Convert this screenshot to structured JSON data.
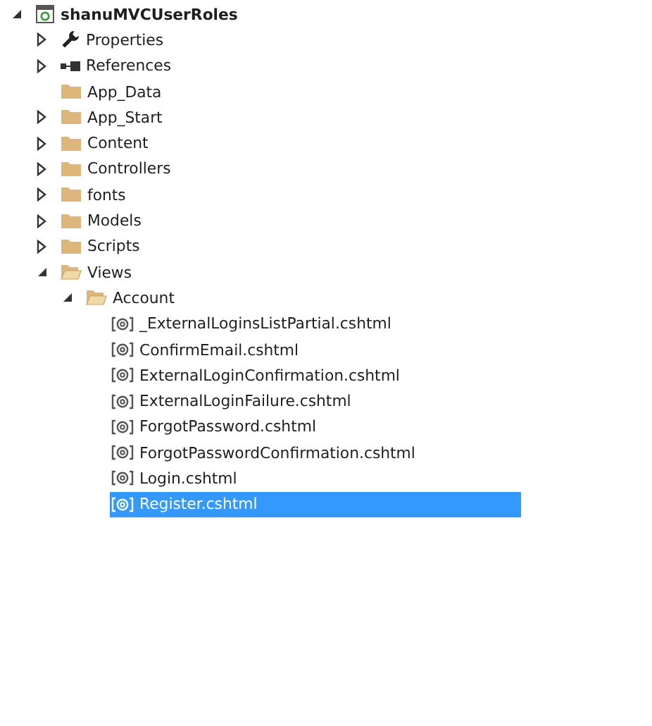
{
  "tree": {
    "label": "shanuMVCUserRoles",
    "kind": "project",
    "expandable": true,
    "expanded": true,
    "selected": false,
    "children": [
      {
        "label": "Properties",
        "kind": "properties",
        "expandable": true,
        "expanded": false,
        "selected": false
      },
      {
        "label": "References",
        "kind": "references",
        "expandable": true,
        "expanded": false,
        "selected": false
      },
      {
        "label": "App_Data",
        "kind": "folder",
        "expandable": false,
        "expanded": false,
        "selected": false
      },
      {
        "label": "App_Start",
        "kind": "folder",
        "expandable": true,
        "expanded": false,
        "selected": false
      },
      {
        "label": "Content",
        "kind": "folder",
        "expandable": true,
        "expanded": false,
        "selected": false
      },
      {
        "label": "Controllers",
        "kind": "folder",
        "expandable": true,
        "expanded": false,
        "selected": false
      },
      {
        "label": "fonts",
        "kind": "folder",
        "expandable": true,
        "expanded": false,
        "selected": false
      },
      {
        "label": "Models",
        "kind": "folder",
        "expandable": true,
        "expanded": false,
        "selected": false
      },
      {
        "label": "Scripts",
        "kind": "folder",
        "expandable": true,
        "expanded": false,
        "selected": false
      },
      {
        "label": "Views",
        "kind": "folder",
        "expandable": true,
        "expanded": true,
        "selected": false,
        "children": [
          {
            "label": "Account",
            "kind": "folder",
            "expandable": true,
            "expanded": true,
            "selected": false,
            "children": [
              {
                "label": "_ExternalLoginsListPartial.cshtml",
                "kind": "file",
                "expandable": false,
                "expanded": false,
                "selected": false
              },
              {
                "label": "ConfirmEmail.cshtml",
                "kind": "file",
                "expandable": false,
                "expanded": false,
                "selected": false
              },
              {
                "label": "ExternalLoginConfirmation.cshtml",
                "kind": "file",
                "expandable": false,
                "expanded": false,
                "selected": false
              },
              {
                "label": "ExternalLoginFailure.cshtml",
                "kind": "file",
                "expandable": false,
                "expanded": false,
                "selected": false
              },
              {
                "label": "ForgotPassword.cshtml",
                "kind": "file",
                "expandable": false,
                "expanded": false,
                "selected": false
              },
              {
                "label": "ForgotPasswordConfirmation.cshtml",
                "kind": "file",
                "expandable": false,
                "expanded": false,
                "selected": false
              },
              {
                "label": "Login.cshtml",
                "kind": "file",
                "expandable": false,
                "expanded": false,
                "selected": false
              },
              {
                "label": "Register.cshtml",
                "kind": "file",
                "expandable": false,
                "expanded": false,
                "selected": true
              }
            ]
          }
        ]
      }
    ]
  }
}
